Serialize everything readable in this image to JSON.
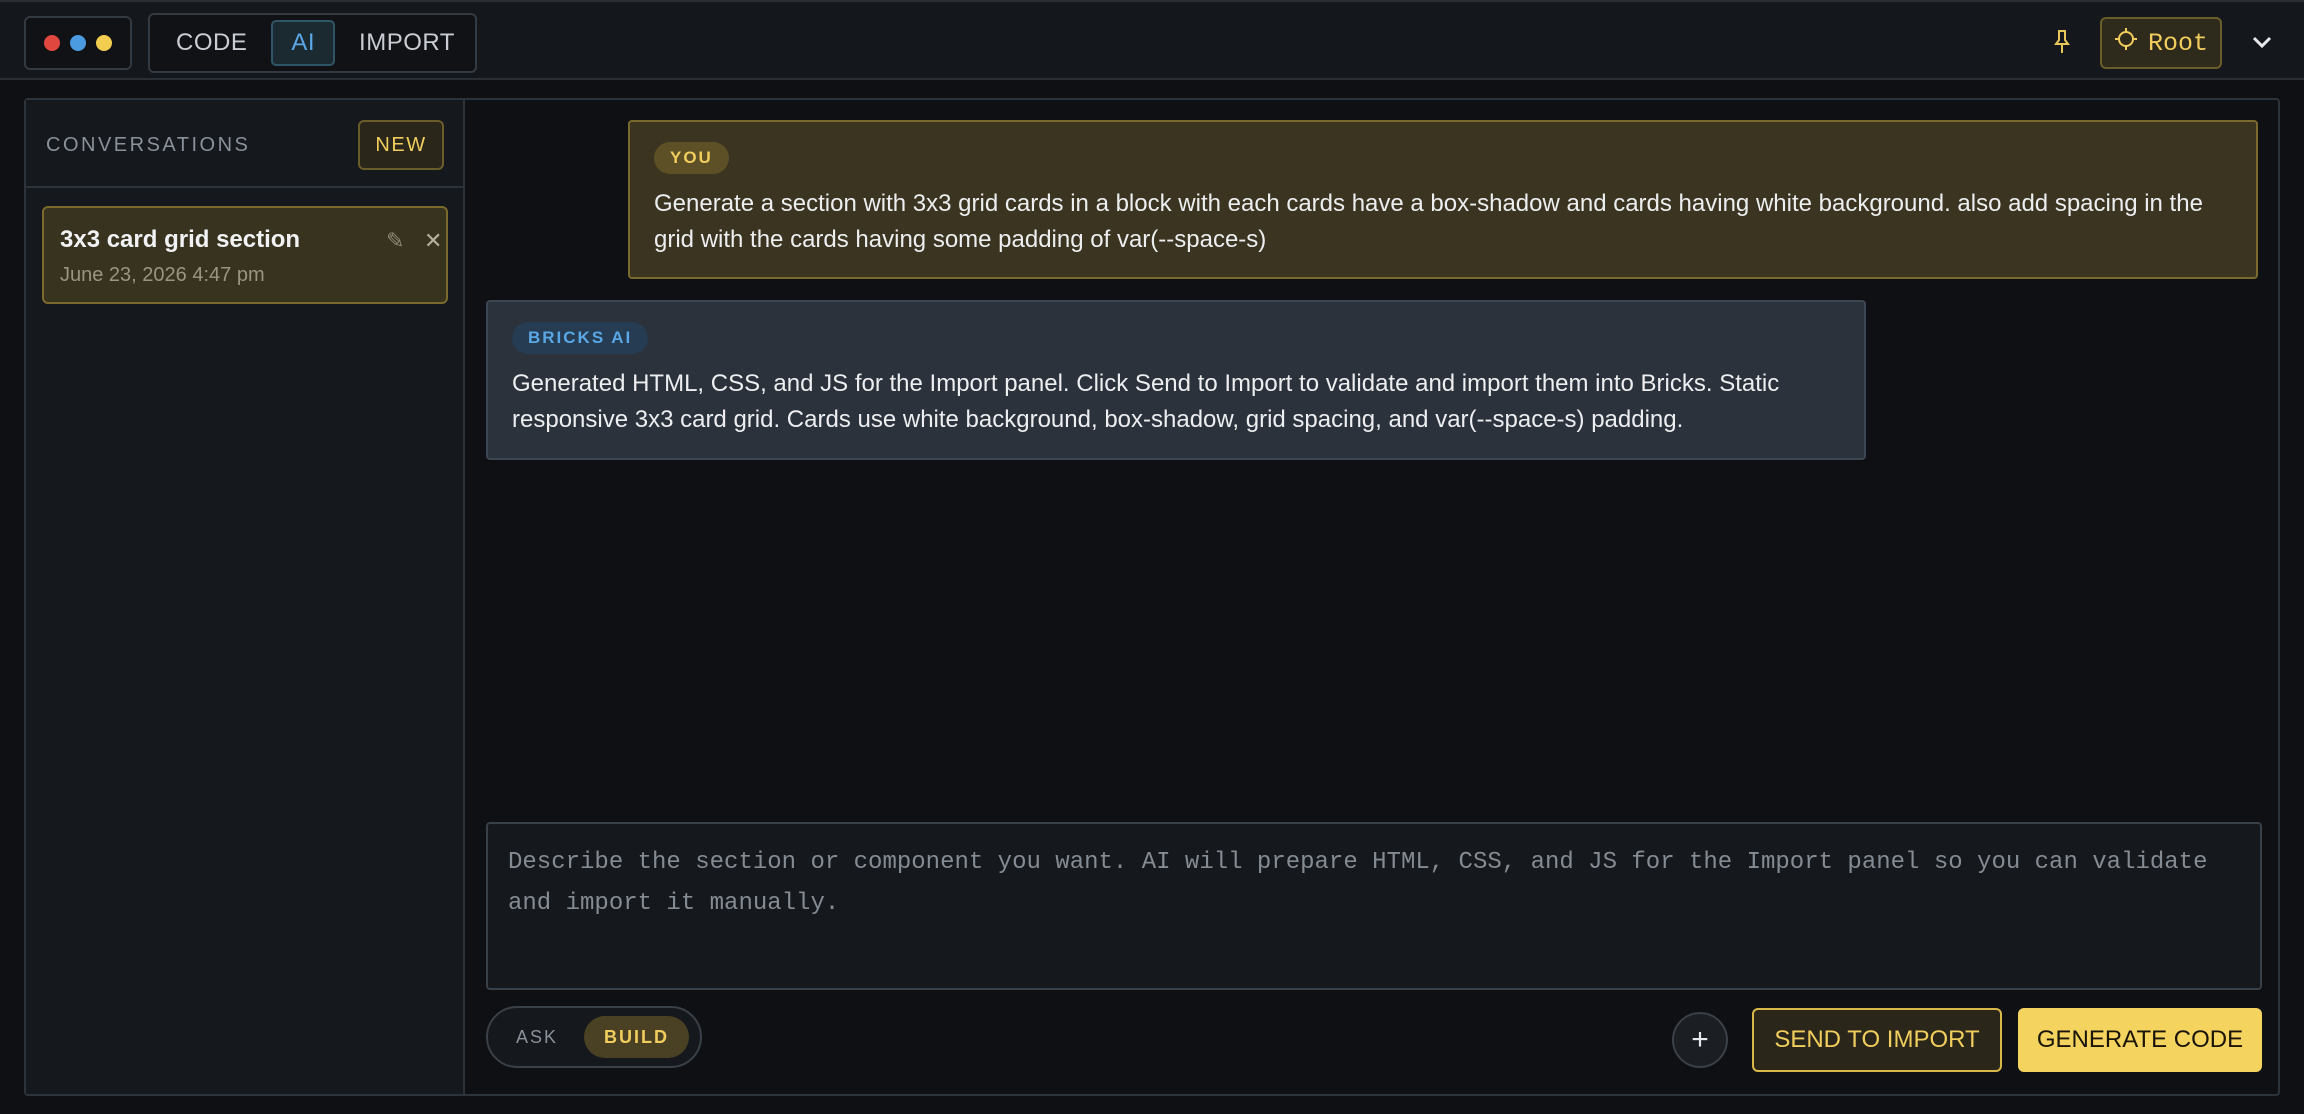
{
  "window": {
    "dot_colors": [
      "#e0473f",
      "#4a9be0",
      "#f2cd50"
    ]
  },
  "topbar": {
    "tabs": [
      {
        "label": "CODE",
        "active": false
      },
      {
        "label": "AI",
        "active": true
      },
      {
        "label": "IMPORT",
        "active": false
      }
    ],
    "pin_icon": "pin-icon",
    "root_label": "Root",
    "root_icon": "crosshair-icon",
    "dropdown_icon": "chevron-down-icon"
  },
  "sidebar": {
    "title": "CONVERSATIONS",
    "new_label": "NEW",
    "conversations": [
      {
        "title": "3x3 card grid section",
        "date": "June 23, 2026 4:47 pm"
      }
    ]
  },
  "messages": [
    {
      "role_label": "YOU",
      "text": "Generate a section with 3x3 grid cards in a block with each cards have a box-shadow and cards having white background. also add spacing in the grid with the cards having some padding of var(--space-s)"
    },
    {
      "role_label": "BRICKS AI",
      "text": "Generated HTML, CSS, and JS for the Import panel. Click Send to Import to validate and import them into Bricks. Static responsive 3x3 card grid. Cards use white background, box-shadow, grid spacing, and var(--space-s) padding."
    }
  ],
  "composer": {
    "placeholder": "Describe the section or component you want. AI will prepare HTML, CSS, and JS for the Import panel so you can validate and import it manually.",
    "value": ""
  },
  "mode_toggle": {
    "options": [
      {
        "label": "ASK",
        "active": false
      },
      {
        "label": "BUILD",
        "active": true
      }
    ]
  },
  "actions": {
    "send_label": "SEND TO IMPORT",
    "generate_label": "GENERATE CODE"
  },
  "colors": {
    "accent_yellow": "#f0cd5d",
    "accent_blue": "#5aa7e6"
  }
}
